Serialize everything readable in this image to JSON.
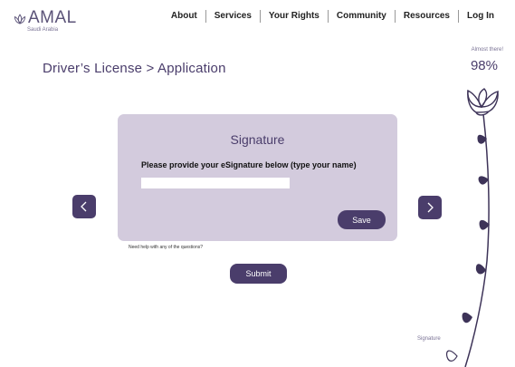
{
  "brand": {
    "name": "AMAL",
    "subtitle": "Saudi Arabia"
  },
  "nav": {
    "items": [
      {
        "label": "About"
      },
      {
        "label": "Services"
      },
      {
        "label": "Your Rights"
      },
      {
        "label": "Community"
      },
      {
        "label": "Resources"
      },
      {
        "label": "Log In"
      }
    ]
  },
  "progress": {
    "label": "Almost there!",
    "value": "98%"
  },
  "breadcrumb": "Driver’s License > Application",
  "card": {
    "title": "Signature",
    "prompt": "Please provide your eSignature below (type your name)",
    "input_value": "",
    "input_placeholder": "",
    "save_label": "Save"
  },
  "help_text": "Need help with any of the questions?",
  "submit_label": "Submit",
  "step_label": "Signature",
  "colors": {
    "accent": "#4a3d6b",
    "card_bg": "#d3cbdd"
  },
  "icons": {
    "prev": "chevron-left-icon",
    "next": "chevron-right-icon",
    "logo": "lotus-icon"
  }
}
